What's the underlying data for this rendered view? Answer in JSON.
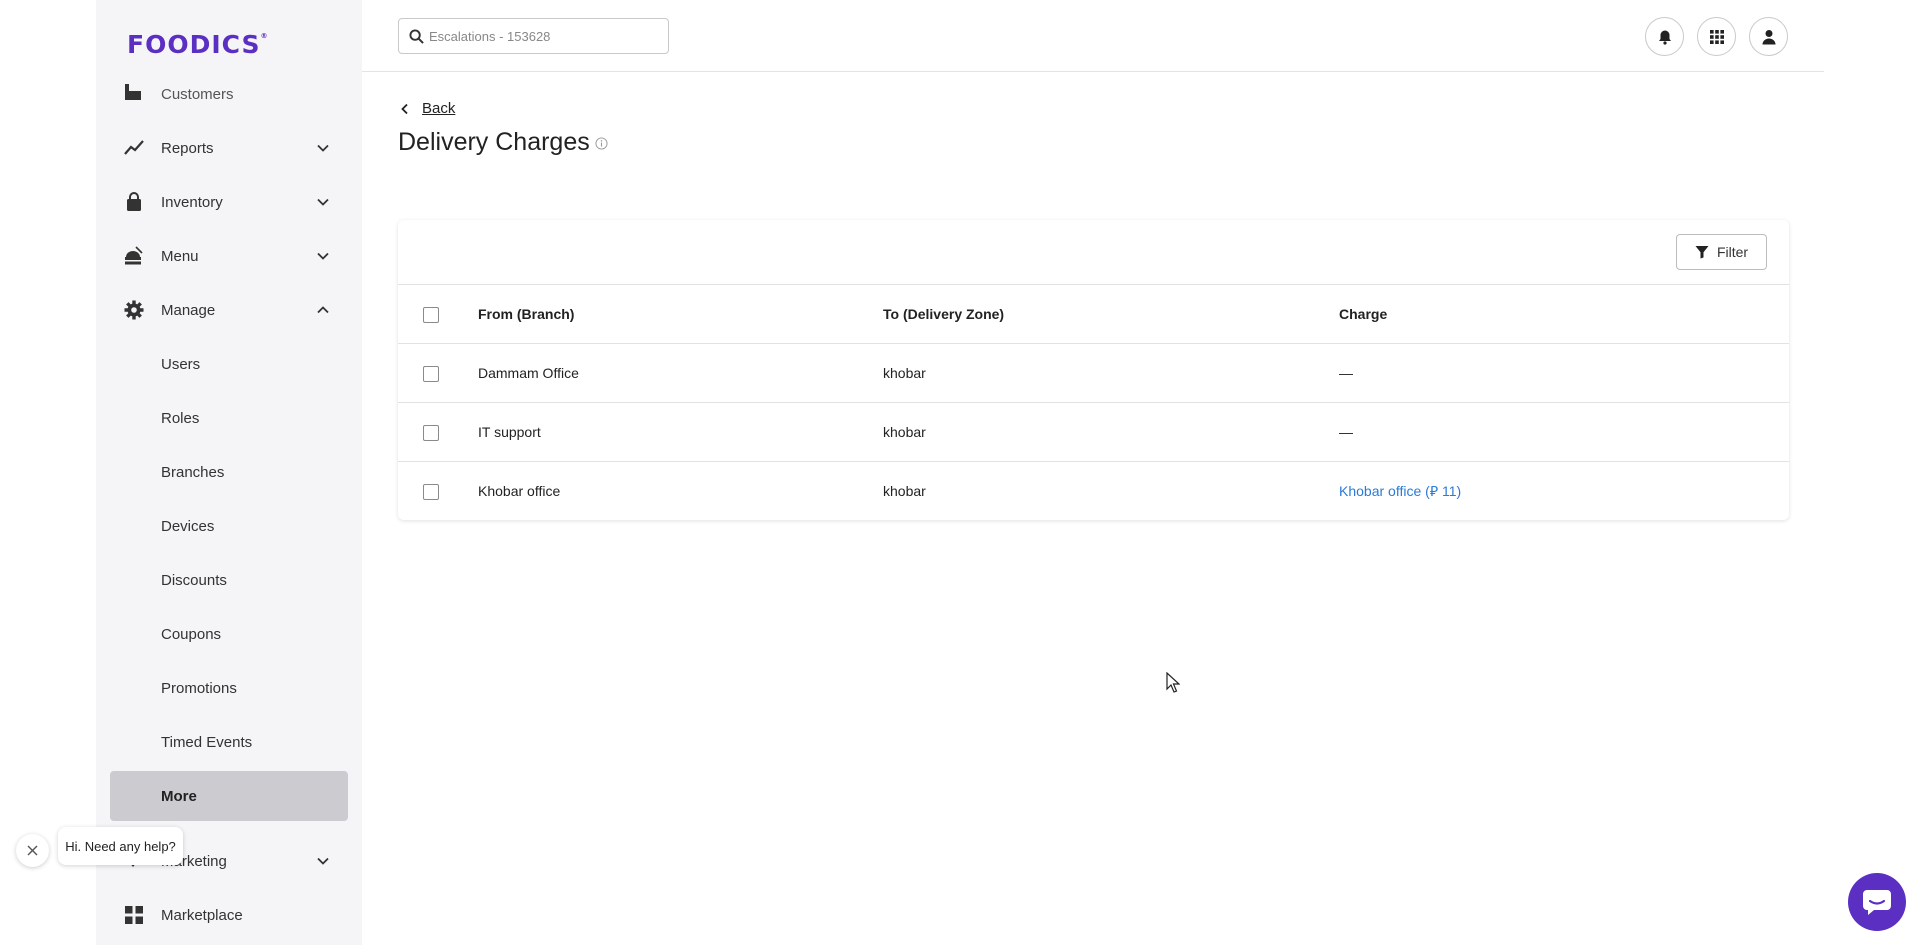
{
  "brand": {
    "logo_text": "FOODICS",
    "registered_mark": "®",
    "accent": "#5a2fc2"
  },
  "sidebar": {
    "partial_item": "Customers",
    "items": [
      {
        "label": "Reports"
      },
      {
        "label": "Inventory"
      },
      {
        "label": "Menu"
      },
      {
        "label": "Manage",
        "expanded": true
      }
    ],
    "sub_items": [
      {
        "label": "Users"
      },
      {
        "label": "Roles"
      },
      {
        "label": "Branches"
      },
      {
        "label": "Devices"
      },
      {
        "label": "Discounts"
      },
      {
        "label": "Coupons"
      },
      {
        "label": "Promotions"
      },
      {
        "label": "Timed Events"
      },
      {
        "label": "More",
        "active": true
      }
    ],
    "bottom_items": [
      {
        "label": "Marketing"
      },
      {
        "label": "Marketplace"
      }
    ]
  },
  "header": {
    "search_placeholder": "Escalations - 153628"
  },
  "page": {
    "back_label": "Back",
    "title": "Delivery Charges",
    "filter_label": "Filter"
  },
  "table": {
    "columns": [
      "From (Branch)",
      "To (Delivery Zone)",
      "Charge"
    ],
    "rows": [
      {
        "from": "Dammam Office",
        "to": "khobar",
        "charge": "—"
      },
      {
        "from": "IT support",
        "to": "khobar",
        "charge": "—"
      },
      {
        "from": "Khobar office",
        "to": "khobar",
        "charge": "Khobar office (⃁ 11)"
      }
    ]
  },
  "help": {
    "bubble_text": "Hi. Need any help?"
  }
}
